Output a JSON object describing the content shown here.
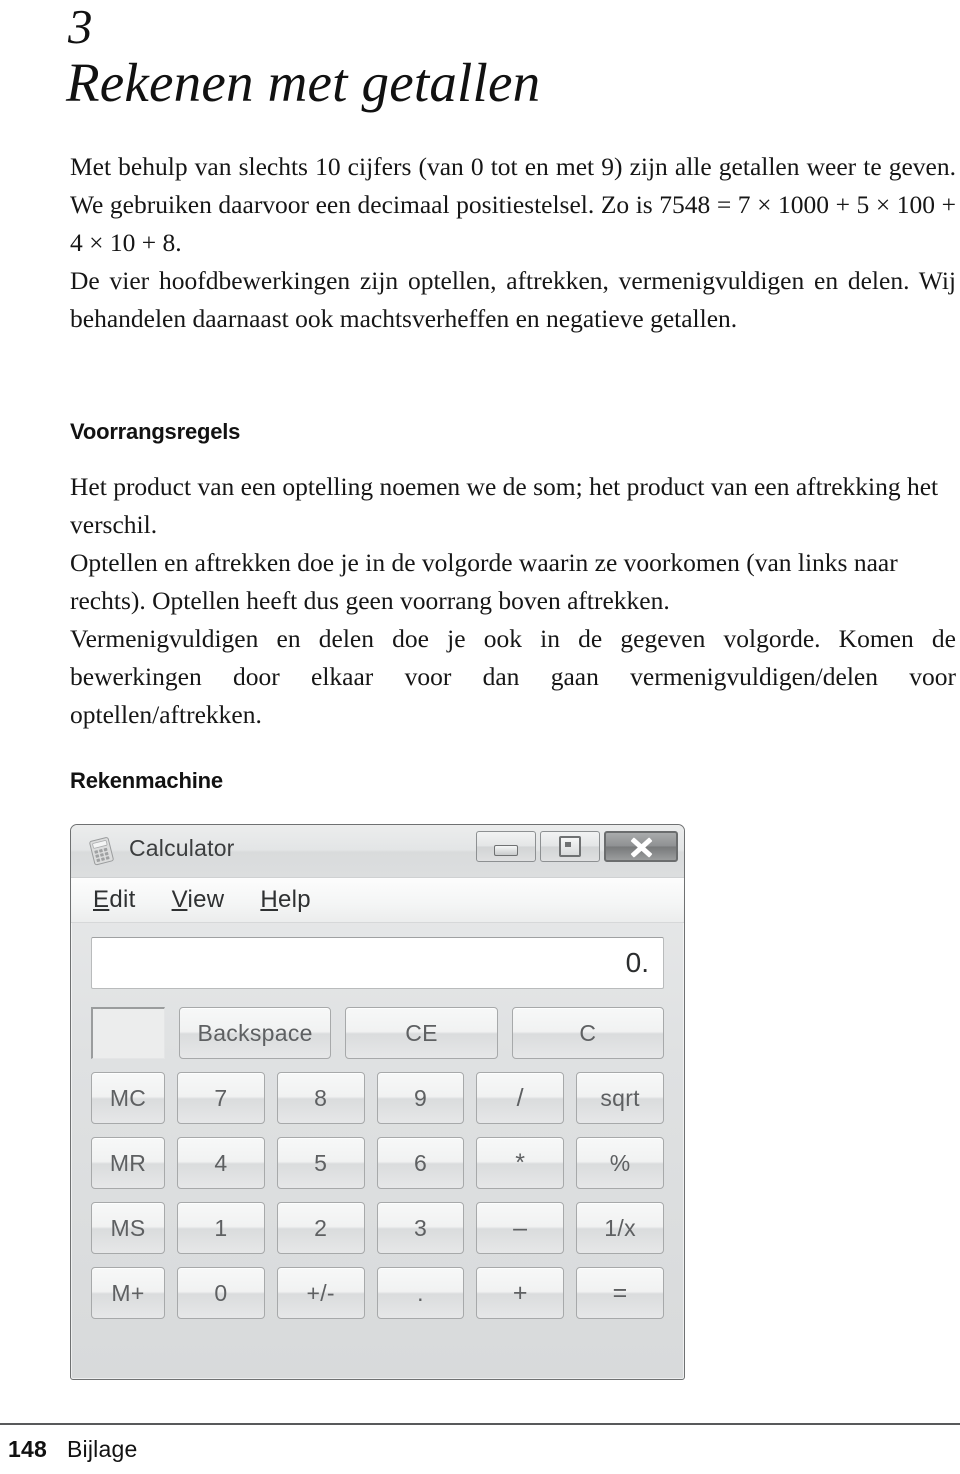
{
  "chapter": {
    "number": "3",
    "title": "Rekenen met getallen"
  },
  "intro": {
    "paragraph1": "Met behulp van slechts 10 cijfers (van 0 tot en met 9) zijn alle getallen weer te geven. We gebruiken daarvoor een decimaal positiestelsel. Zo is 7548 = 7 × 1000 + 5 × 100 + 4 × 10 + 8.",
    "paragraph2": "De vier hoofdbewerkingen zijn optellen, aftrekken, vermenigvuldigen en delen. Wij behandelen daarnaast ook machtsverheffen en negatieve getallen."
  },
  "sections": {
    "voorrangsregels_heading": "Voorrangsregels",
    "voorrangsregels_p1": "Het product van een optelling noemen we de som; het product van een aftrekking het verschil.",
    "voorrangsregels_p2": "Optellen en aftrekken doe je in de volgorde waarin ze voorkomen (van links naar rechts). Optellen heeft dus geen voorrang boven aftrekken.",
    "voorrangsregels_p3": "Vermenigvuldigen en delen doe je ook in de gegeven volgorde. Komen de bewerkingen door elkaar voor dan gaan vermenigvuldigen/delen voor optellen/aftrekken.",
    "rekenmachine_heading": "Rekenmachine"
  },
  "calculator": {
    "title": "Calculator",
    "icon": "calculator-icon",
    "window_controls": {
      "minimize": "minimize-icon",
      "maximize": "maximize-icon",
      "close": "close-icon"
    },
    "menu": [
      {
        "accel": "E",
        "rest": "dit"
      },
      {
        "accel": "V",
        "rest": "iew"
      },
      {
        "accel": "H",
        "rest": "elp"
      }
    ],
    "display_value": "0.",
    "memory_indicator": "",
    "rows": [
      {
        "keys": [
          "Backspace",
          "CE",
          "C"
        ]
      },
      {
        "keys": [
          "MC",
          "7",
          "8",
          "9",
          "/",
          "sqrt"
        ]
      },
      {
        "keys": [
          "MR",
          "4",
          "5",
          "6",
          "*",
          "%"
        ]
      },
      {
        "keys": [
          "MS",
          "1",
          "2",
          "3",
          "–",
          "1/x"
        ]
      },
      {
        "keys": [
          "M+",
          "0",
          "+/-",
          ".",
          "+",
          "="
        ]
      }
    ]
  },
  "footer": {
    "page_number": "148",
    "label": "Bijlage"
  }
}
